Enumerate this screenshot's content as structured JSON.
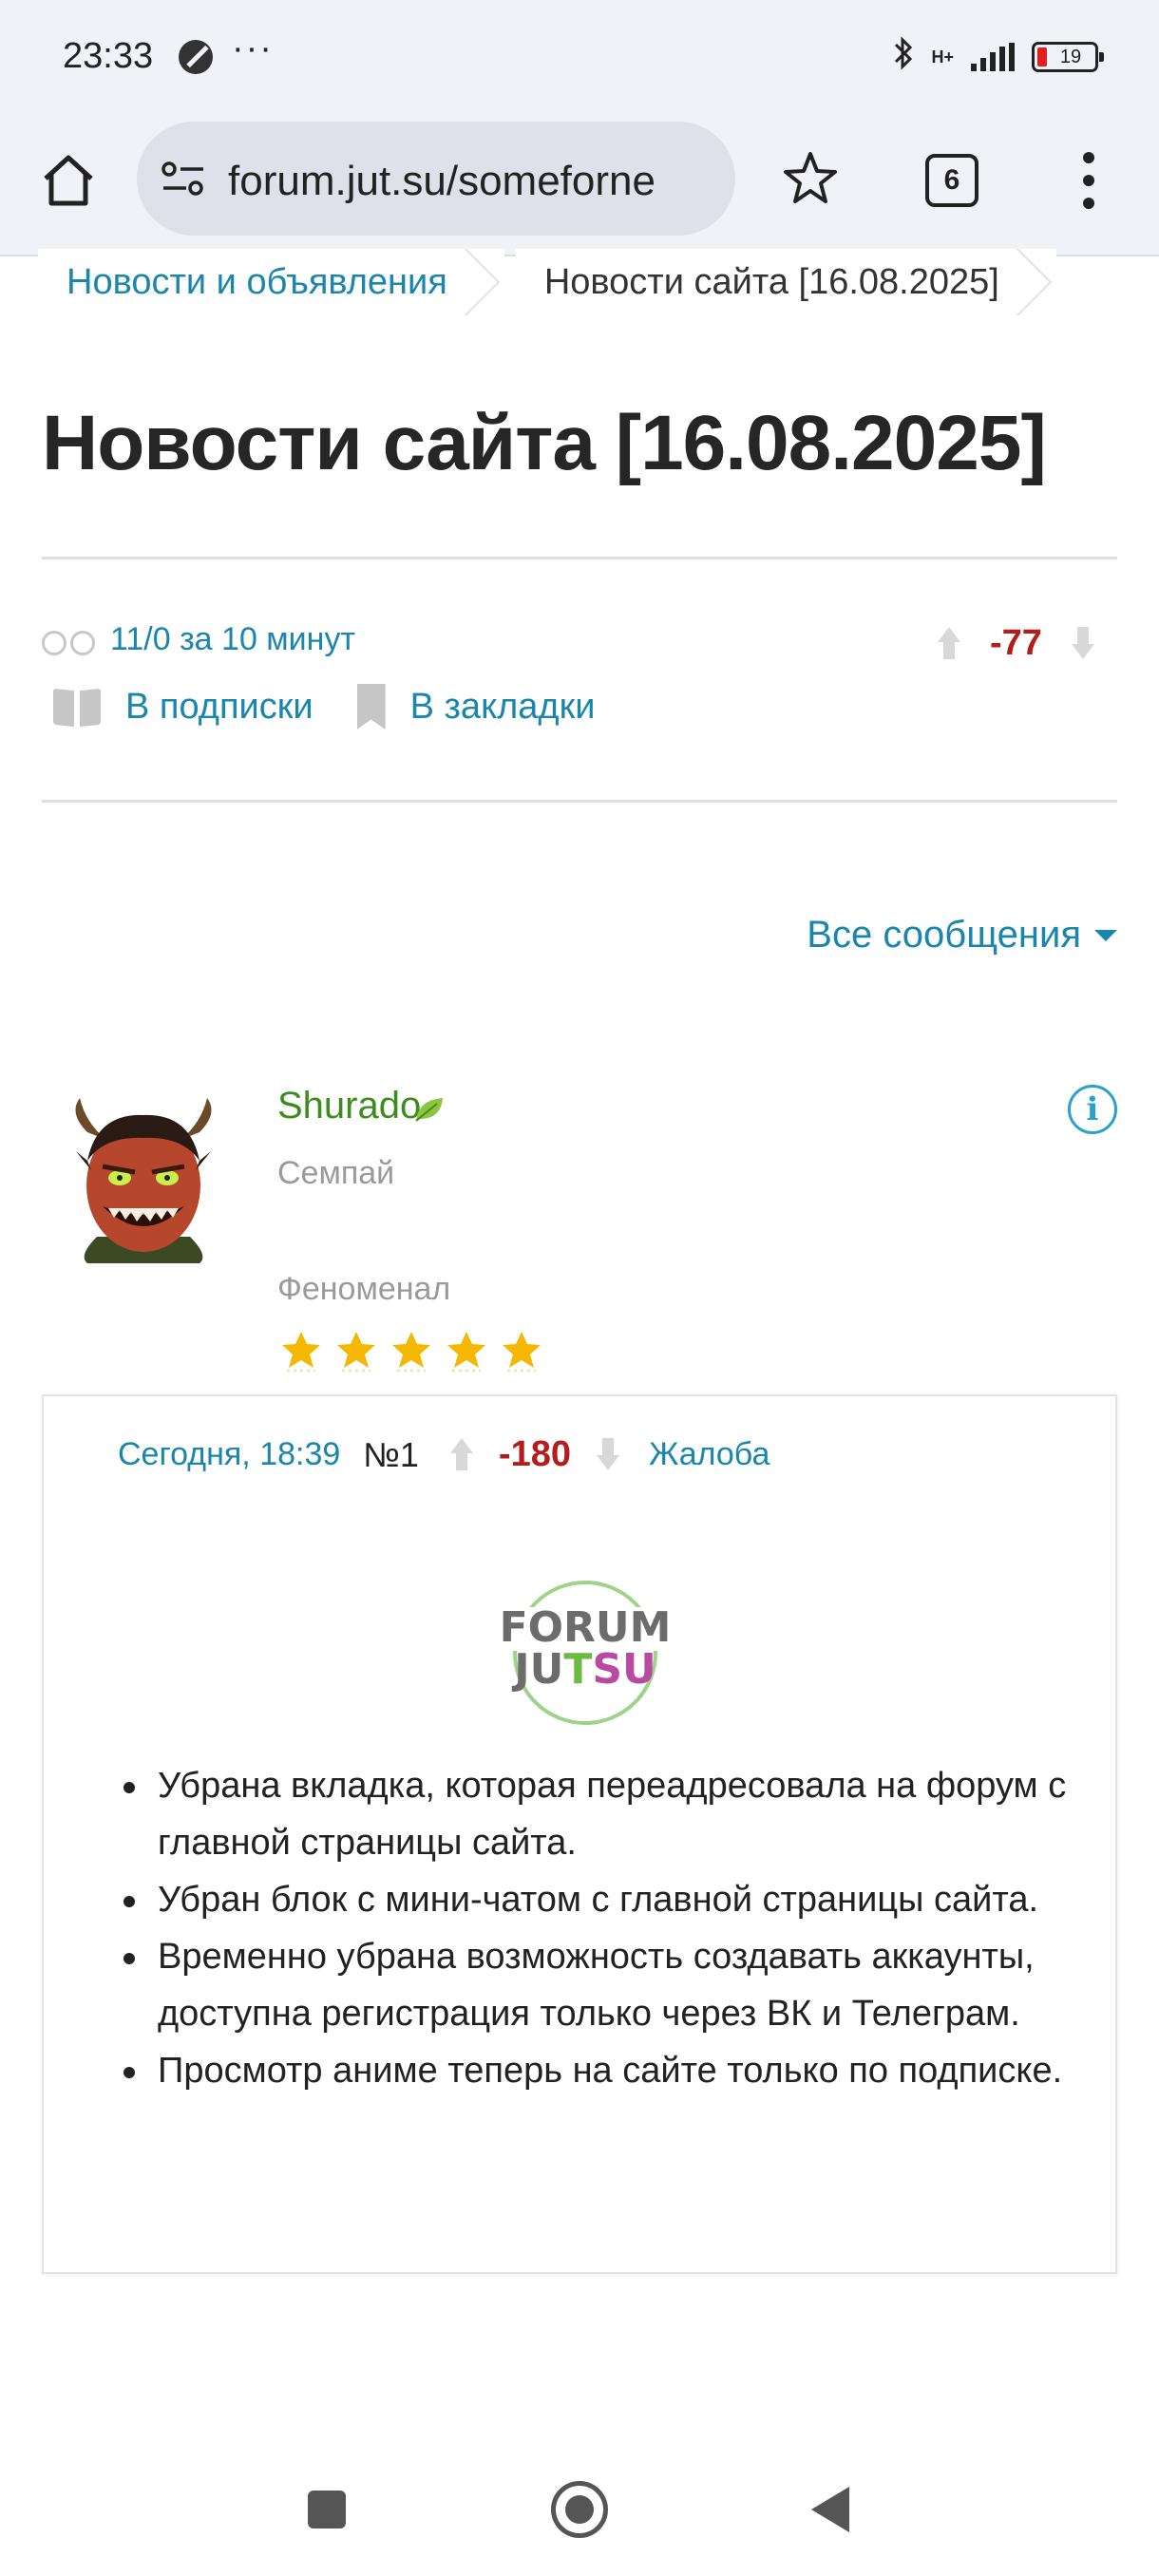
{
  "status_bar": {
    "time": "23:33",
    "network_label": "H+",
    "battery": "19"
  },
  "browser": {
    "url": "forum.jut.su/someforne",
    "tab_count": "6"
  },
  "breadcrumbs": [
    {
      "label": "Новости и объявления"
    },
    {
      "label": "Новости сайта [16.08.2025]"
    }
  ],
  "thread": {
    "title": "Новости сайта [16.08.2025]",
    "views": "11/0 за 10 минут",
    "score": "-77",
    "subscribe_label": "В подписки",
    "bookmark_label": "В закладки"
  },
  "all_messages_label": "Все сообщения",
  "author": {
    "name": "Shurado",
    "rank": "Семпай",
    "status": "Феноменал",
    "stars": 5
  },
  "post": {
    "date": "Сегодня, 18:39",
    "number": "№1",
    "score": "-180",
    "report_label": "Жалоба",
    "logo_line1": "FORUM",
    "logo_line2_a": "JU",
    "logo_line2_b": "T",
    "logo_line2_c": "SU",
    "items": [
      "Убрана вкладка, которая переадресовала на форум с главной страницы сайта.",
      "Убран блок с мини-чатом с главной страницы сайта.",
      "Временно убрана возможность создавать аккаунты, доступна регистрация только через ВК и Телеграм.",
      "Просмотр аниме теперь на сайте только по подписке."
    ]
  },
  "colors": {
    "link": "#1a86ad",
    "score_negative": "#b51c1c",
    "author_name": "#3c8d1e"
  }
}
